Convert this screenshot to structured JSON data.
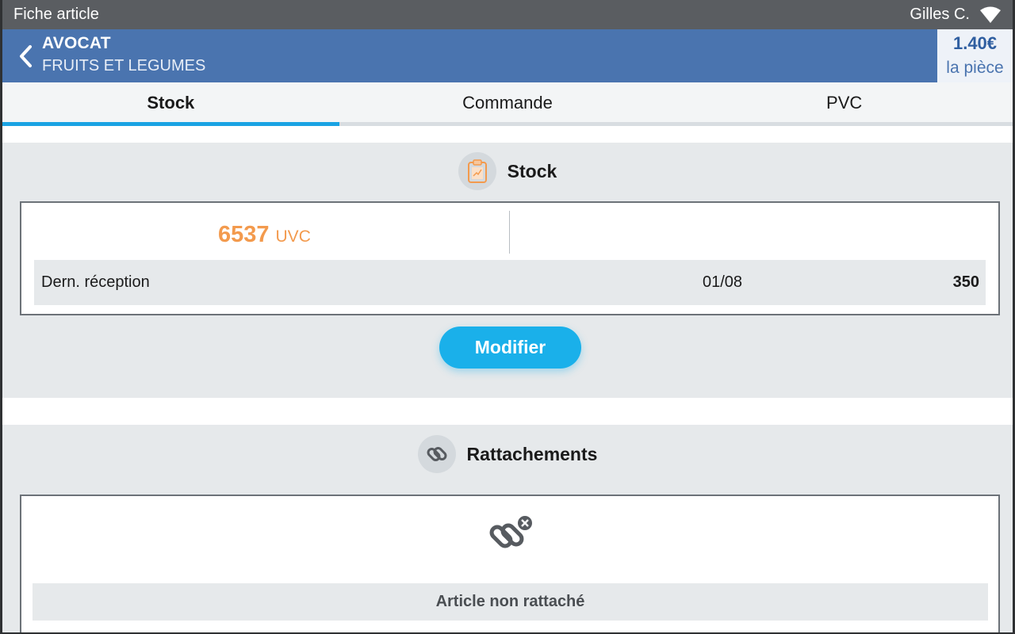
{
  "statusbar": {
    "screen_title": "Fiche article",
    "user": "Gilles C.",
    "wifi_icon": "wifi-icon"
  },
  "header": {
    "title": "AVOCAT",
    "subtitle": "FRUITS ET LEGUMES",
    "price": "1.40€",
    "unit": "la pièce",
    "back_icon": "chevron-left-icon"
  },
  "tabs": [
    {
      "label": "Stock",
      "active": true
    },
    {
      "label": "Commande",
      "active": false
    },
    {
      "label": "PVC",
      "active": false
    }
  ],
  "stock": {
    "title": "Stock",
    "icon": "clipboard-chart-icon",
    "quantity": "6537",
    "quantity_unit": "UVC",
    "last_reception": {
      "label": "Dern. réception",
      "date": "01/08",
      "value": "350"
    },
    "modify_label": "Modifier"
  },
  "rattachements": {
    "title": "Rattachements",
    "icon": "link-icon",
    "status_icon": "unlink-icon",
    "status_text": "Article non rattaché"
  },
  "colors": {
    "header": "#4a74af",
    "accent": "#1ab0ea",
    "quantity": "#f39a4d",
    "statusbar": "#5a5d61"
  }
}
